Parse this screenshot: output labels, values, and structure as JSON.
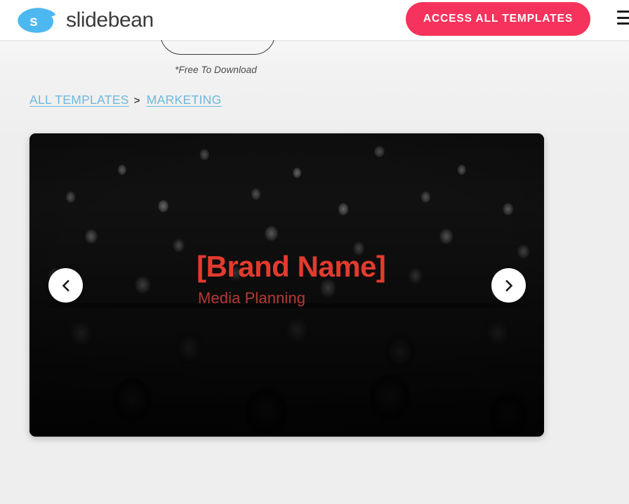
{
  "header": {
    "logo": {
      "mark_icon": "slidebean-bean-icon",
      "mark_letter": "s",
      "wordmark": "slidebean",
      "brand_blue": "#4db8ef"
    },
    "cta": {
      "label": "ACCESS ALL TEMPLATES",
      "color": "#f5335c"
    },
    "menu": {
      "icon": "hamburger-menu-icon"
    }
  },
  "hero_remnant": {
    "free_note": "*Free To Download"
  },
  "breadcrumb": {
    "items": [
      {
        "label": "ALL TEMPLATES"
      },
      {
        "label": "MARKETING"
      }
    ],
    "separator": ">",
    "link_color": "#6cb8e0"
  },
  "slide": {
    "title": "[Brand Name]",
    "subtitle": "Media Planning",
    "title_color": "#e23b2e",
    "subtitle_color": "#b43a32",
    "background_image": "dark-crowd-audience-photo",
    "prev_icon": "chevron-left-icon",
    "next_icon": "chevron-right-icon"
  }
}
